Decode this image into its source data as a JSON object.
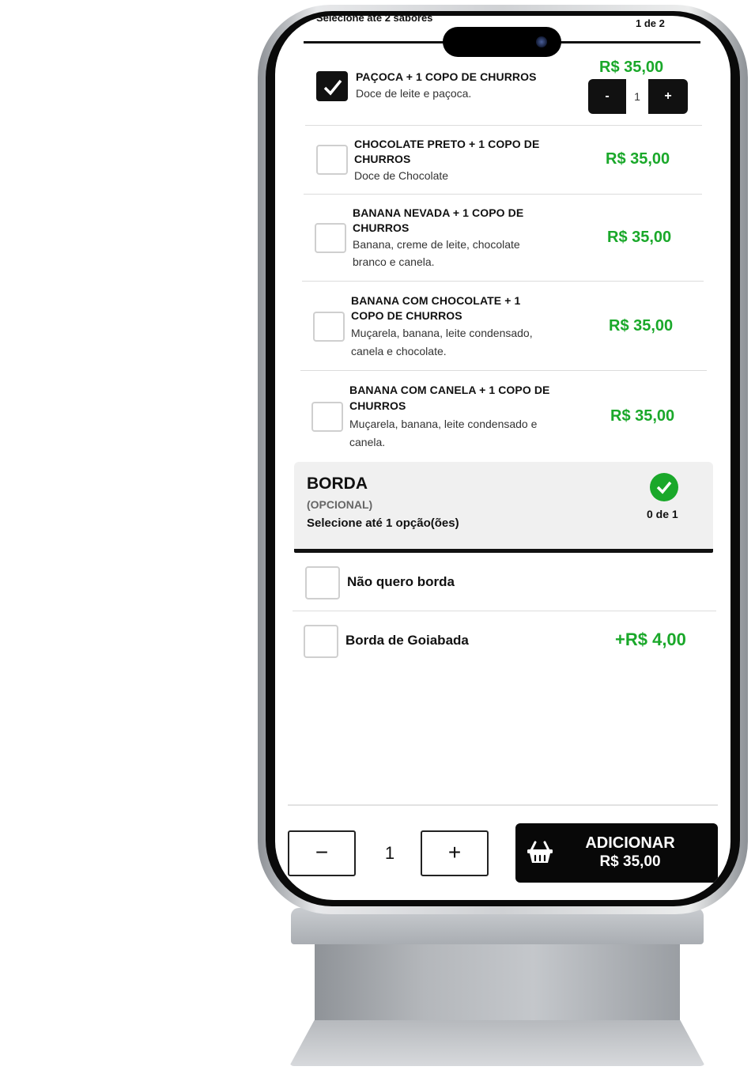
{
  "header": {
    "hint": "Selecione até 2 sabores",
    "count": "1 de 2"
  },
  "flavors": [
    {
      "title_lines": [
        "PAÇOCA + 1 COPO DE CHURROS"
      ],
      "desc_lines": [
        "Doce de leite e paçoca."
      ],
      "price": "R$ 35,00",
      "checked": true,
      "quantity": "1"
    },
    {
      "title_lines": [
        "CHOCOLATE PRETO + 1 COPO DE",
        "CHURROS"
      ],
      "desc_lines": [
        "Doce de Chocolate"
      ],
      "price": "R$ 35,00",
      "checked": false
    },
    {
      "title_lines": [
        "BANANA NEVADA + 1 COPO DE",
        "CHURROS"
      ],
      "desc_lines": [
        "Banana, creme de leite, chocolate",
        "branco e canela."
      ],
      "price": "R$ 35,00",
      "checked": false
    },
    {
      "title_lines": [
        "BANANA COM CHOCOLATE + 1",
        "COPO DE CHURROS"
      ],
      "desc_lines": [
        "Muçarela, banana, leite condensado,",
        "canela e chocolate."
      ],
      "price": "R$ 35,00",
      "checked": false
    },
    {
      "title_lines": [
        "BANANA COM CANELA + 1 COPO DE",
        "CHURROS"
      ],
      "desc_lines": [
        "Muçarela, banana, leite condensado e",
        "canela."
      ],
      "price": "R$ 35,00",
      "checked": false
    }
  ],
  "stepper_small": {
    "minus": "-",
    "plus": "+"
  },
  "borda": {
    "title": "BORDA",
    "optional": "(OPCIONAL)",
    "select_hint": "Selecione até 1 opção(ões)",
    "count": "0 de 1",
    "options": [
      {
        "label": "Não quero borda",
        "price": "",
        "checked": false
      },
      {
        "label": "Borda de Goiabada",
        "price": "+R$ 4,00",
        "checked": false
      }
    ]
  },
  "footer": {
    "minus": "−",
    "quantity": "1",
    "plus": "+",
    "add_label": "ADICIONAR",
    "add_price": "R$ 35,00"
  },
  "colors": {
    "price_green": "#1aa82a",
    "dark": "#080808"
  },
  "icons": {
    "check": "check-icon",
    "cart": "shopping-basket-icon",
    "camera": "camera-icon"
  }
}
